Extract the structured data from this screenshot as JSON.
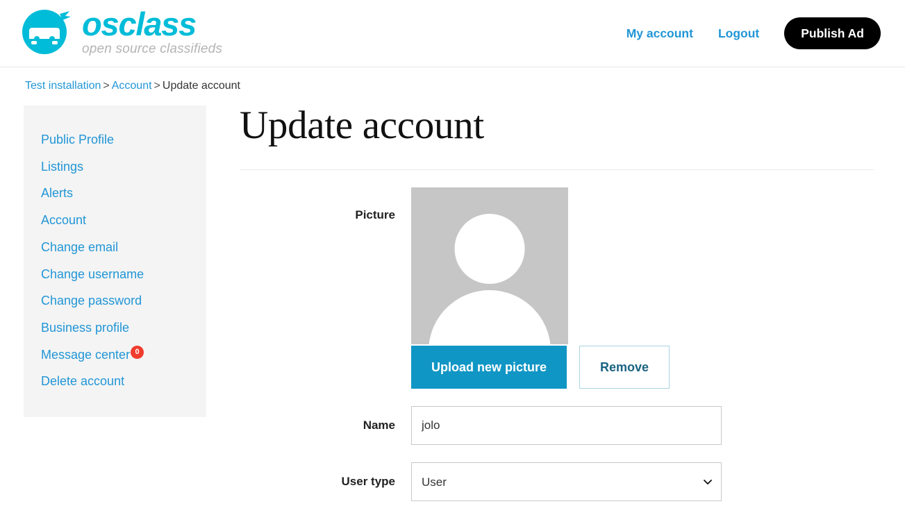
{
  "theme": {
    "brand_cyan": "#00bcd8",
    "link_blue": "#2196d6",
    "button_blue": "#1096c5",
    "badge_red": "#f03b2d",
    "sidebar_bg": "#f4f4f4",
    "avatar_bg": "#c6c6c6",
    "publish_bg": "#000000"
  },
  "header": {
    "logo_icon": "osclass-car-logo-icon",
    "brand_name": "osclass",
    "brand_tagline": "open source classifieds",
    "nav": [
      {
        "label": "My account",
        "name": "nav-my-account"
      },
      {
        "label": "Logout",
        "name": "nav-logout"
      }
    ],
    "publish_label": "Publish Ad"
  },
  "breadcrumb": {
    "items": [
      {
        "label": "Test installation",
        "link": true
      },
      {
        "label": "Account",
        "link": true
      },
      {
        "label": "Update account",
        "link": false
      }
    ],
    "separator": ">"
  },
  "sidebar": {
    "items": [
      {
        "label": "Public Profile",
        "name": "sidebar-item-public-profile",
        "badge": null
      },
      {
        "label": "Listings",
        "name": "sidebar-item-listings",
        "badge": null
      },
      {
        "label": "Alerts",
        "name": "sidebar-item-alerts",
        "badge": null
      },
      {
        "label": "Account",
        "name": "sidebar-item-account",
        "badge": null
      },
      {
        "label": "Change email",
        "name": "sidebar-item-change-email",
        "badge": null
      },
      {
        "label": "Change username",
        "name": "sidebar-item-change-username",
        "badge": null
      },
      {
        "label": "Change password",
        "name": "sidebar-item-change-password",
        "badge": null
      },
      {
        "label": "Business profile",
        "name": "sidebar-item-business-profile",
        "badge": null
      },
      {
        "label": "Message center",
        "name": "sidebar-item-message-center",
        "badge": "0"
      },
      {
        "label": "Delete account",
        "name": "sidebar-item-delete-account",
        "badge": null
      }
    ]
  },
  "main": {
    "title": "Update account",
    "fields": {
      "picture": {
        "label": "Picture",
        "avatar_icon": "user-placeholder-avatar-icon",
        "upload_label": "Upload new picture",
        "remove_label": "Remove"
      },
      "name": {
        "label": "Name",
        "value": "jolo",
        "placeholder": ""
      },
      "user_type": {
        "label": "User type",
        "value": "User",
        "options": [
          "User"
        ],
        "chevron_icon": "chevron-down-icon"
      }
    }
  }
}
